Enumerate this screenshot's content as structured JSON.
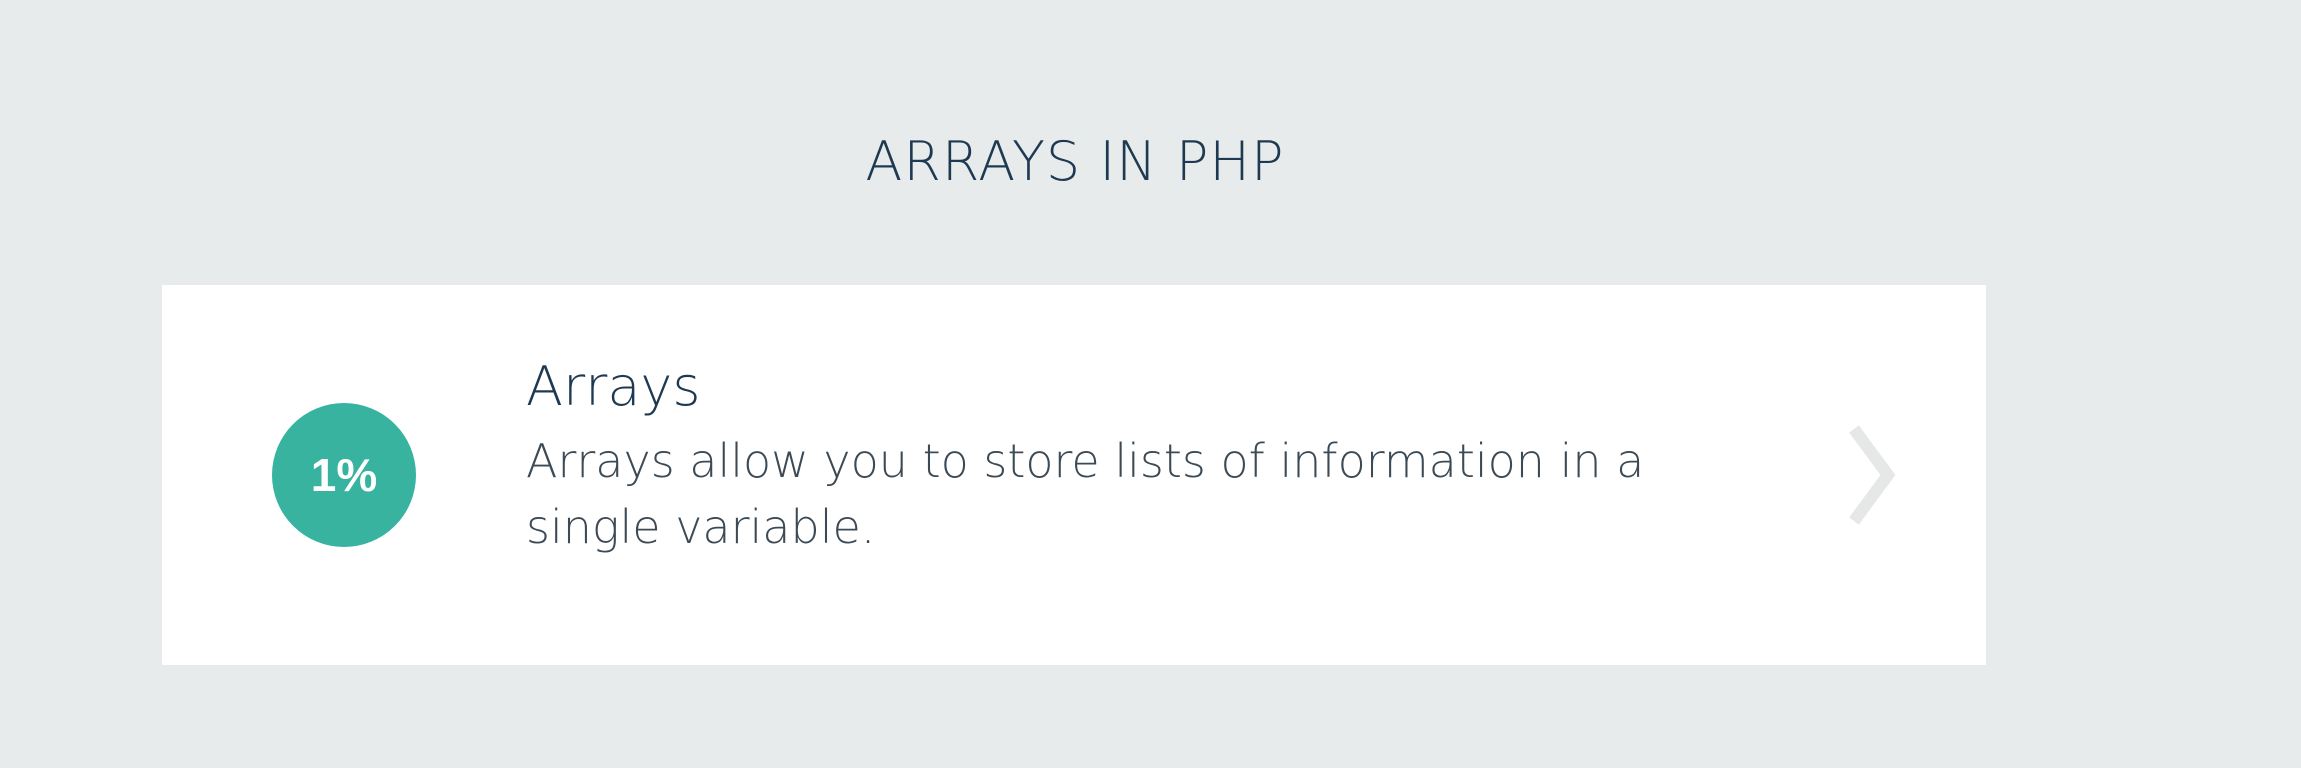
{
  "section": {
    "title": "ARRAYS IN PHP"
  },
  "lesson": {
    "progress_label": "1%",
    "progress_percent": 1,
    "title": "Arrays",
    "description": "Arrays allow you to store lists of information in a single variable.",
    "icon": "chevron-right-icon"
  },
  "colors": {
    "background": "#e8ebeb",
    "card": "#ffffff",
    "accent": "#37b3a0",
    "title": "#1e3a52",
    "chevron": "#e6e8e8"
  }
}
